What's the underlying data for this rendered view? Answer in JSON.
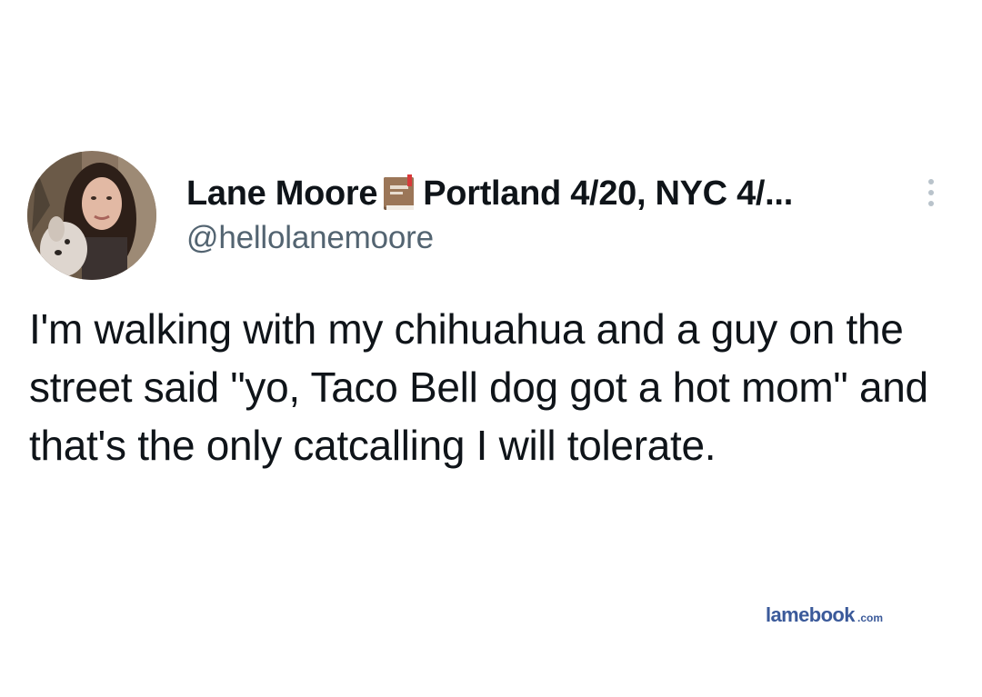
{
  "tweet": {
    "display_name": "Lane Moore",
    "name_emoji": "book-icon",
    "name_suffix": "Portland 4/20, NYC 4/...",
    "handle": "@hellolanemoore",
    "text": "I'm walking with my chihuahua and a guy on the street said \"yo, Taco Bell dog got a hot mom\" and that's the only catcalling I will tolerate.",
    "more_icon": "more-dots-icon"
  },
  "watermark": {
    "brand": "lamebook",
    "tld": ".com"
  },
  "colors": {
    "text": "#0f1419",
    "secondary": "#536471",
    "more_icon": "#b9c3cb",
    "watermark": "#3b5a9a"
  }
}
